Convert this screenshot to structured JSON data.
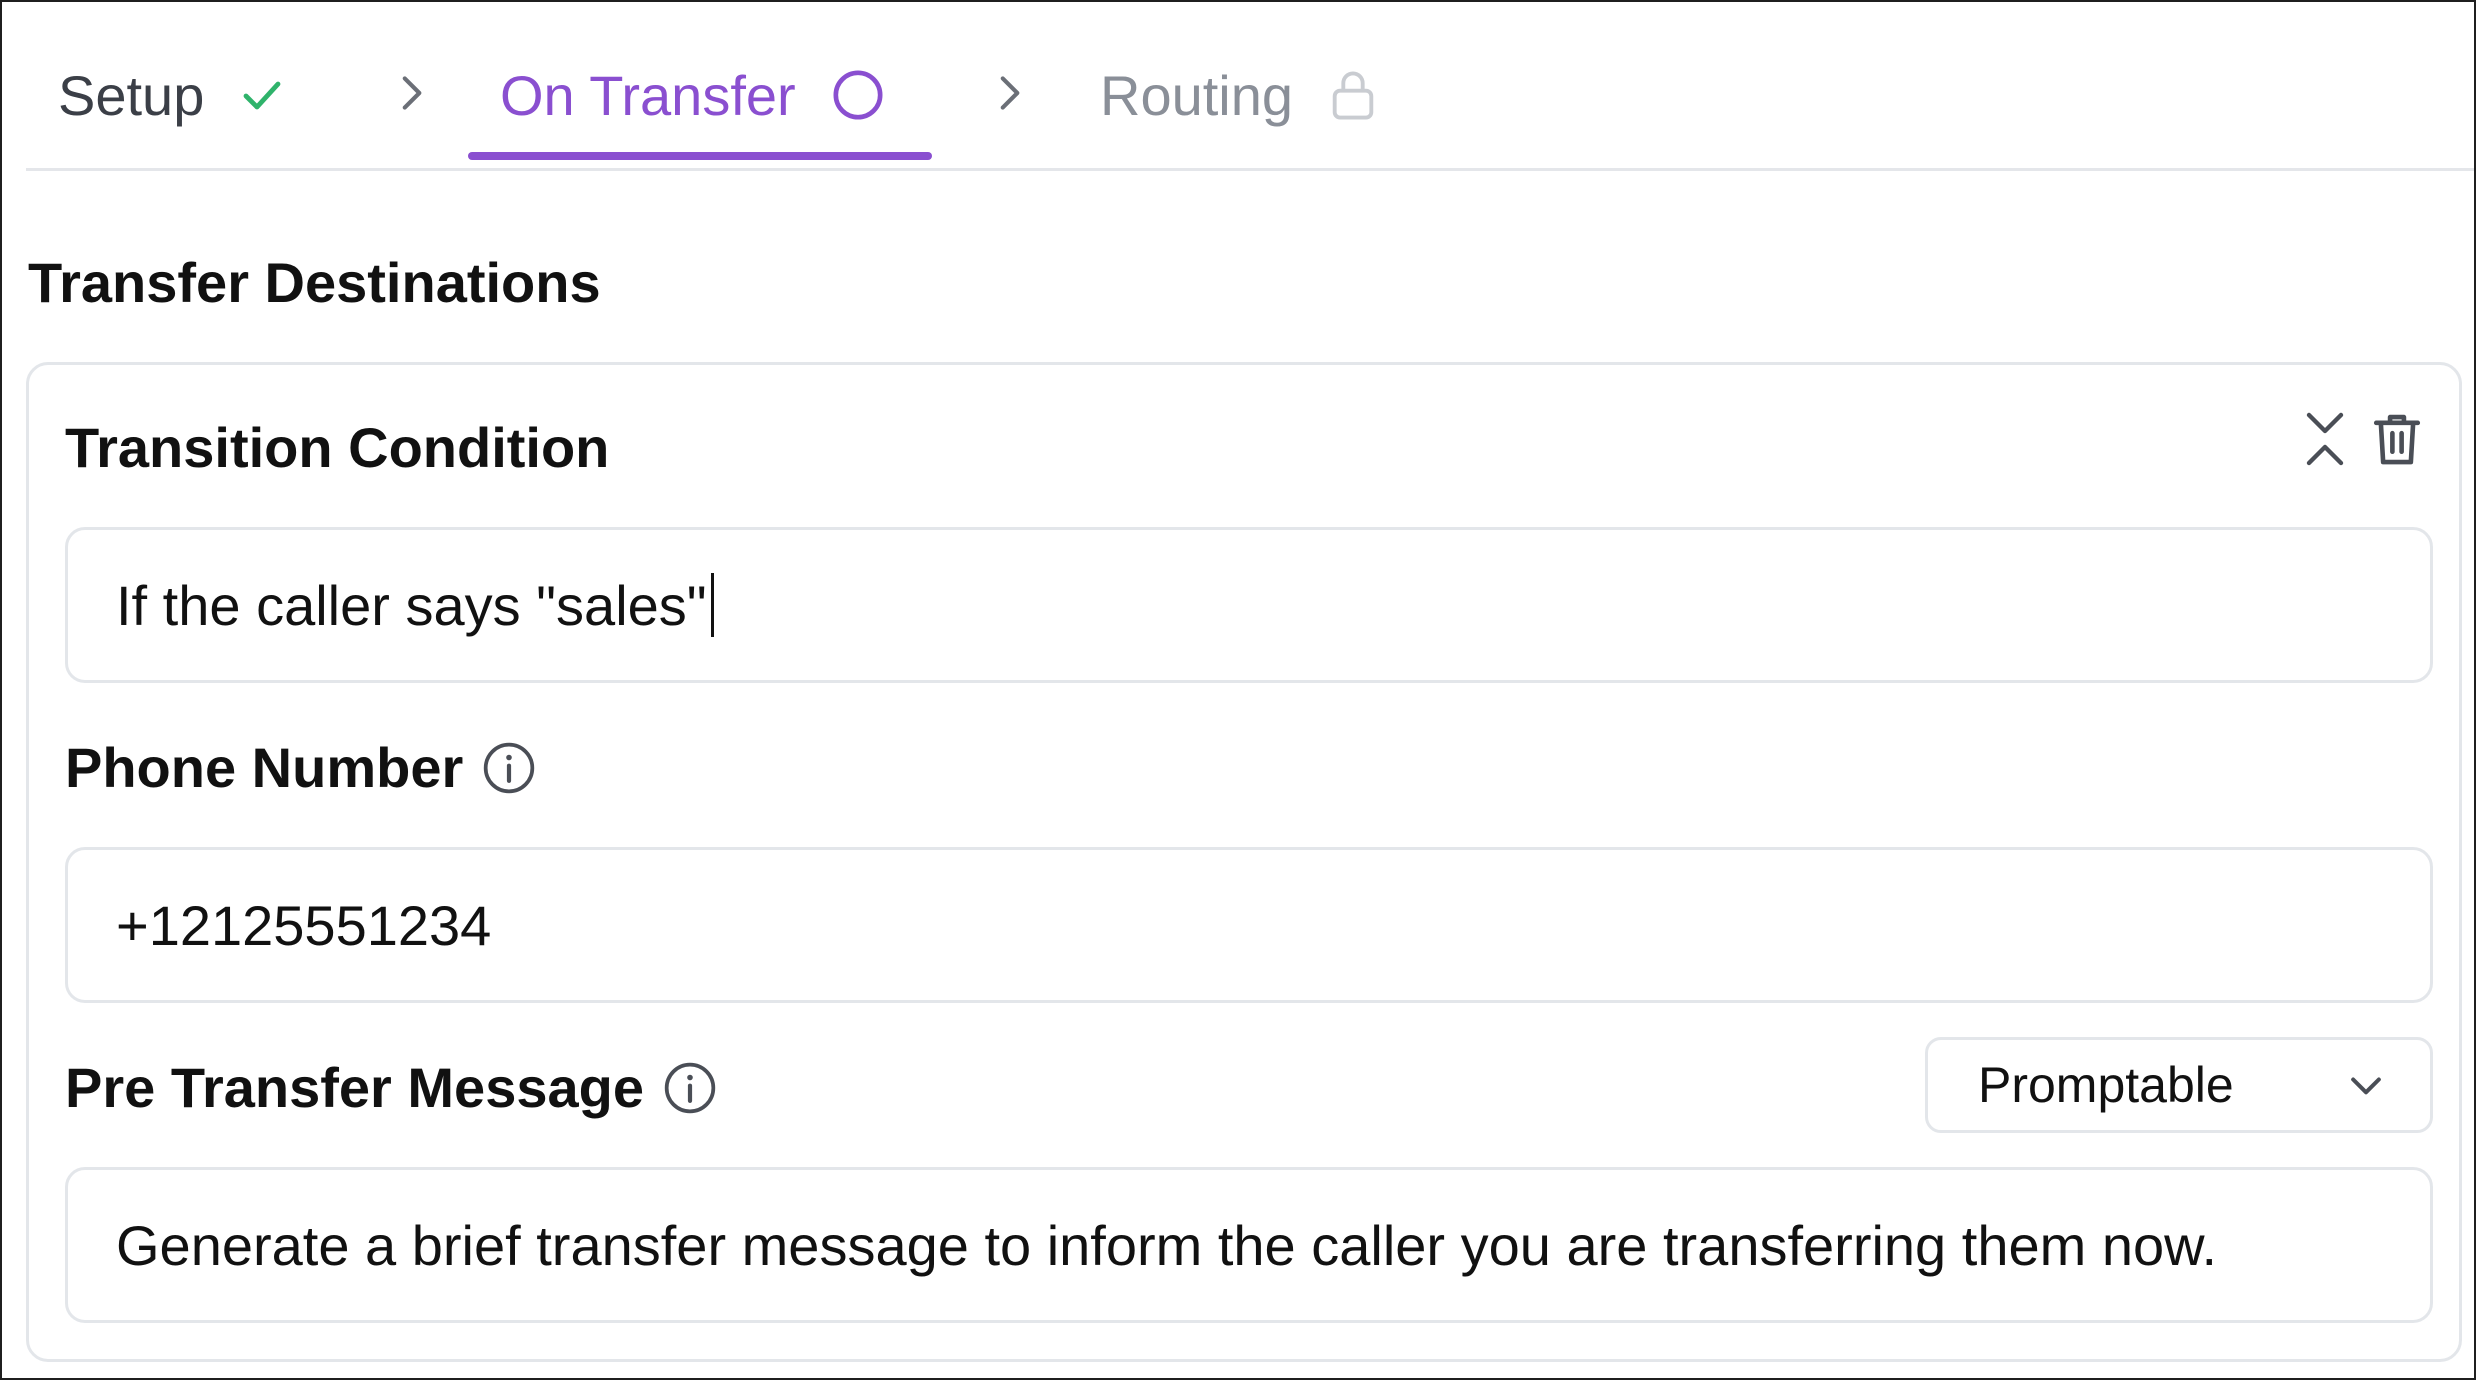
{
  "stepper": {
    "steps": [
      {
        "label": "Setup",
        "state": "complete"
      },
      {
        "label": "On Transfer",
        "state": "active"
      },
      {
        "label": "Routing",
        "state": "locked"
      }
    ]
  },
  "section": {
    "title": "Transfer Destinations"
  },
  "destination": {
    "condition_label": "Transition Condition",
    "condition_value": "If the caller says \"sales\"",
    "phone_label": "Phone Number",
    "phone_value": "+12125551234",
    "message_label": "Pre Transfer Message",
    "message_mode": "Promptable",
    "message_value": "Generate a brief transfer message to inform the caller you are transferring them now."
  },
  "icons": {
    "check": "check-icon",
    "chevron_right": "chevron-right-icon",
    "circle": "circle-icon",
    "lock": "lock-icon",
    "collapse": "collapse-icon",
    "trash": "trash-icon",
    "info": "info-icon",
    "chevron_down": "chevron-down-icon"
  },
  "colors": {
    "accent": "#8a4fd0",
    "complete": "#2fb36b",
    "muted": "#8a8f98",
    "border": "#e3e6ea"
  }
}
